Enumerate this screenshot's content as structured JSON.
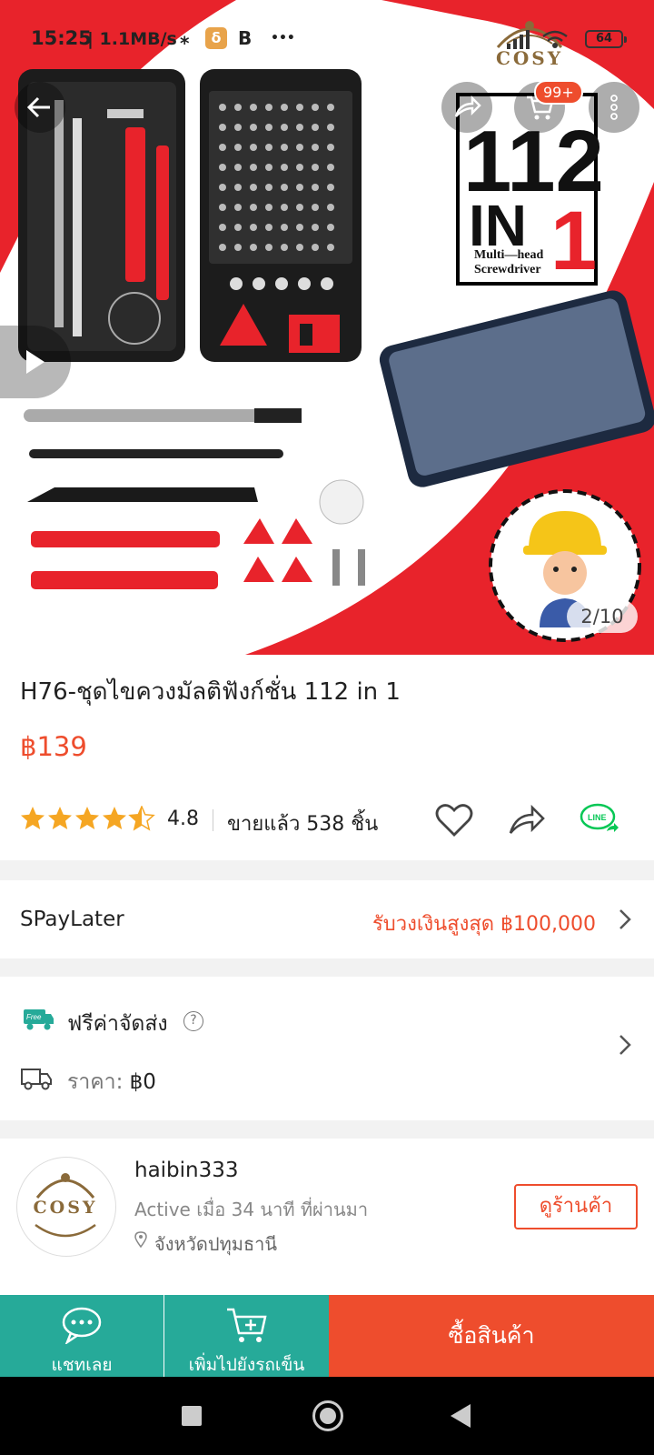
{
  "status_bar": {
    "time": "15:25",
    "speed": "| 1.1MB/s",
    "app_letter": "δ",
    "b_icon": "B",
    "dots": "•••",
    "battery": "64"
  },
  "hero": {
    "brand_text": "COSY",
    "cart_badge": "99+",
    "image_counter": "2/10",
    "box_text_top": "112",
    "box_text_mid": "IN 1",
    "box_text_sub1": "Multi—head",
    "box_text_sub2": "Screwdriver",
    "icons": [
      "back-arrow-icon",
      "share-icon",
      "cart-icon",
      "more-icon",
      "play-icon"
    ]
  },
  "product": {
    "title": "H76-ชุดไขควงมัลติฟังก์ชั่น 112 in 1",
    "price": "฿139",
    "rating": "4.8",
    "rating_fraction": 0.96,
    "sold": "ขายแล้ว 538 ชิ้น"
  },
  "spaylater": {
    "label": "SPayLater",
    "value": "รับวงเงินสูงสุด ฿100,000"
  },
  "shipping": {
    "free_badge": "Free",
    "free_text": "ฟรีค่าจัดส่ง",
    "help": "?",
    "price_label": "ราคา: ",
    "price_value": "฿0"
  },
  "shop": {
    "avatar_text": "COSY",
    "name": "haibin333",
    "active": "Active เมื่อ 34 นาที ที่ผ่านมา",
    "location": "จังหวัดปทุมธานี",
    "view_button": "ดูร้านค้า"
  },
  "bottom_bar": {
    "chat_label": "แชทเลย",
    "cart_label": "เพิ่มไปยังรถเข็น",
    "buy_label": "ซื้อสินค้า"
  },
  "colors": {
    "accent": "#ee4d2d",
    "teal": "#26aa99",
    "star": "#f5a623",
    "line_green": "#06c755"
  }
}
